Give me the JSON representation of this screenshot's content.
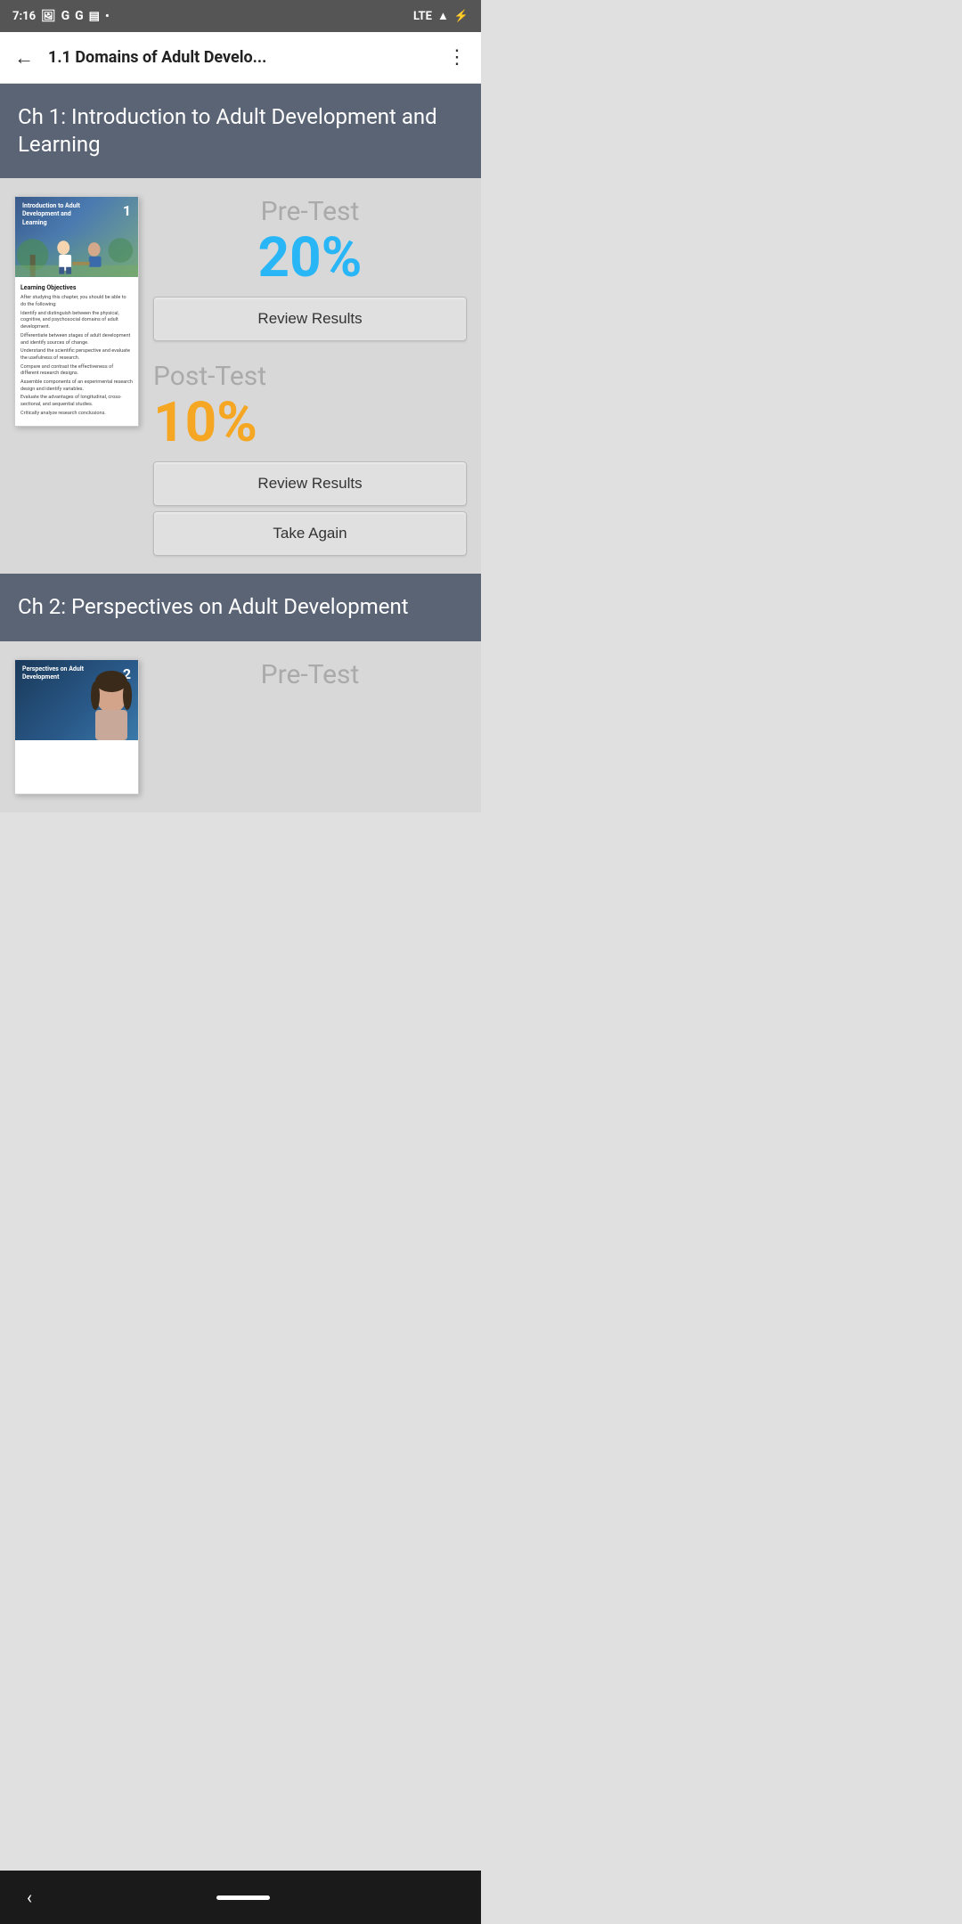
{
  "statusBar": {
    "time": "7:16",
    "signal": "LTE",
    "battery": "⚡"
  },
  "appBar": {
    "backIcon": "←",
    "title": "1.1 Domains of Adult Develo...",
    "moreIcon": "⋮"
  },
  "chapter1": {
    "title": "Ch 1: Introduction to Adult Development and Learning",
    "book": {
      "coverTitle": "Introduction to Adult Development and Learning",
      "coverNumber": "1",
      "learningObjectivesTitle": "Learning Objectives",
      "learningObjectivesIntro": "After studying this chapter, you should be able to do the following:",
      "objectives": [
        "Identify and distinguish between the physical, cognitive, and psychosocial domains of adult development.",
        "Differentiate between stages of adult development and identify sources of change.",
        "Understand the scientific perspective and evaluate the usefulness of research.",
        "Compare and contrast the effectiveness of different research designs.",
        "Assemble components of an experimental research design and identify variables.",
        "Evaluate the advantages of longitudinal, cross-sectional, and sequential studies.",
        "Critically analyze research conclusions."
      ]
    },
    "preTest": {
      "label": "Pre-Test",
      "score": "20%",
      "reviewBtn": "Review Results"
    },
    "postTest": {
      "label": "Post-Test",
      "score": "10%",
      "reviewBtn": "Review Results",
      "takeAgainBtn": "Take Again"
    }
  },
  "chapter2": {
    "title": "Ch 2: Perspectives on Adult Development",
    "book": {
      "coverTitle": "Perspectives on Adult Development",
      "coverNumber": "2"
    },
    "preTest": {
      "label": "Pre-Test"
    }
  },
  "colors": {
    "preTestScore": "#29b6f6",
    "postTestScore": "#f5a623",
    "chapterHeaderBg": "#5a6475",
    "contentBg": "#d8d8d8"
  }
}
